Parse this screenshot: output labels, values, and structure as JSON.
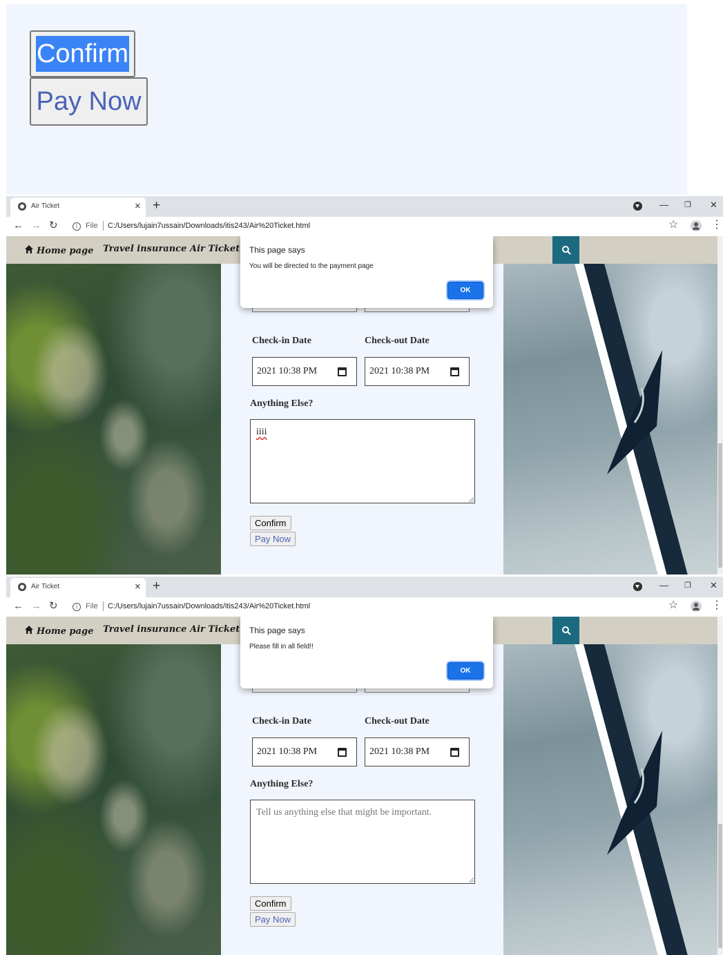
{
  "zoom": {
    "confirm_label": "Confirm",
    "paynow_label": "Pay Now"
  },
  "browser": {
    "tab_title": "Air Ticket",
    "tab_close": "×",
    "new_tab": "+",
    "file_label": "File",
    "url": "C:/Users/lujain7ussain/Downloads/itis243/Air%20Ticket.html"
  },
  "navbar": {
    "home": "Home page",
    "insurance": "Travel insurance",
    "air_ticket": "Air Ticket"
  },
  "form": {
    "checkin_label": "Check-in Date",
    "checkout_label": "Check-out Date",
    "checkin_value": "2021 10:38 PM",
    "checkout_value": "2021 10:38 PM",
    "anything_label": "Anything Else?",
    "confirm_label": "Confirm",
    "paynow_label": "Pay Now"
  },
  "windows": [
    {
      "dialog": {
        "title": "This page says",
        "message": "You will be directed to the payment page",
        "ok": "OK"
      },
      "textarea_value": "iiii",
      "textarea_placeholder": ""
    },
    {
      "dialog": {
        "title": "This page says",
        "message": "Please fill in all field!!",
        "ok": "OK"
      },
      "textarea_value": "",
      "textarea_placeholder": "Tell us anything else that might be important."
    }
  ],
  "colors": {
    "page_bg": "#f1f5fd",
    "navbar_bg": "#d3cfc3",
    "search_bg": "#1c6a80",
    "ok_button": "#1a73e8",
    "selection": "#3b84f7"
  }
}
